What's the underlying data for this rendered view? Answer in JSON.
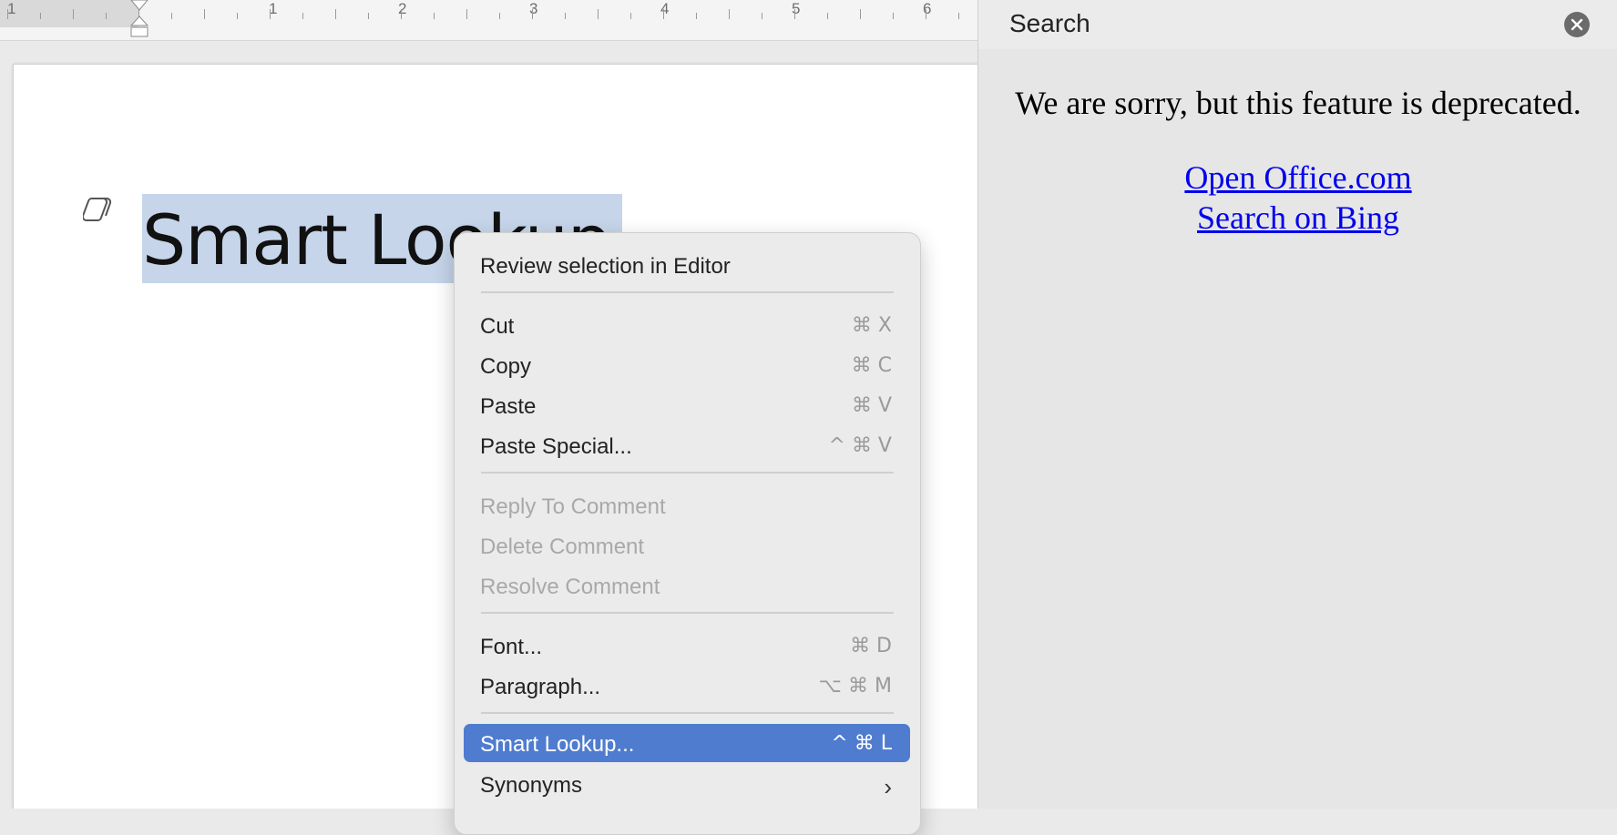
{
  "ruler": {
    "labels": [
      "1",
      "1",
      "2",
      "3",
      "4",
      "5",
      "6"
    ]
  },
  "document": {
    "selected_text": "Smart Lookup"
  },
  "context_menu": {
    "review": {
      "label": "Review selection in Editor"
    },
    "cut": {
      "label": "Cut",
      "shortcut": "⌘ X"
    },
    "copy": {
      "label": "Copy",
      "shortcut": "⌘ C"
    },
    "paste": {
      "label": "Paste",
      "shortcut": "⌘ V"
    },
    "paste_special": {
      "label": "Paste Special...",
      "shortcut": "^ ⌘ V"
    },
    "reply_comment": {
      "label": "Reply To Comment"
    },
    "delete_comment": {
      "label": "Delete Comment"
    },
    "resolve_comment": {
      "label": "Resolve Comment"
    },
    "font": {
      "label": "Font...",
      "shortcut": "⌘ D"
    },
    "paragraph": {
      "label": "Paragraph...",
      "shortcut": "⌥ ⌘ M"
    },
    "smart_lookup": {
      "label": "Smart Lookup...",
      "shortcut": "^ ⌘ L"
    },
    "synonyms": {
      "label": "Synonyms"
    }
  },
  "search_pane": {
    "title": "Search",
    "message": "We are sorry, but this feature is deprecated.",
    "link_office": "Open Office.com",
    "link_bing": "Search on Bing"
  },
  "colors": {
    "highlight": "#4f7ccf",
    "selection": "#c6d5ea",
    "link": "#0000ee"
  }
}
